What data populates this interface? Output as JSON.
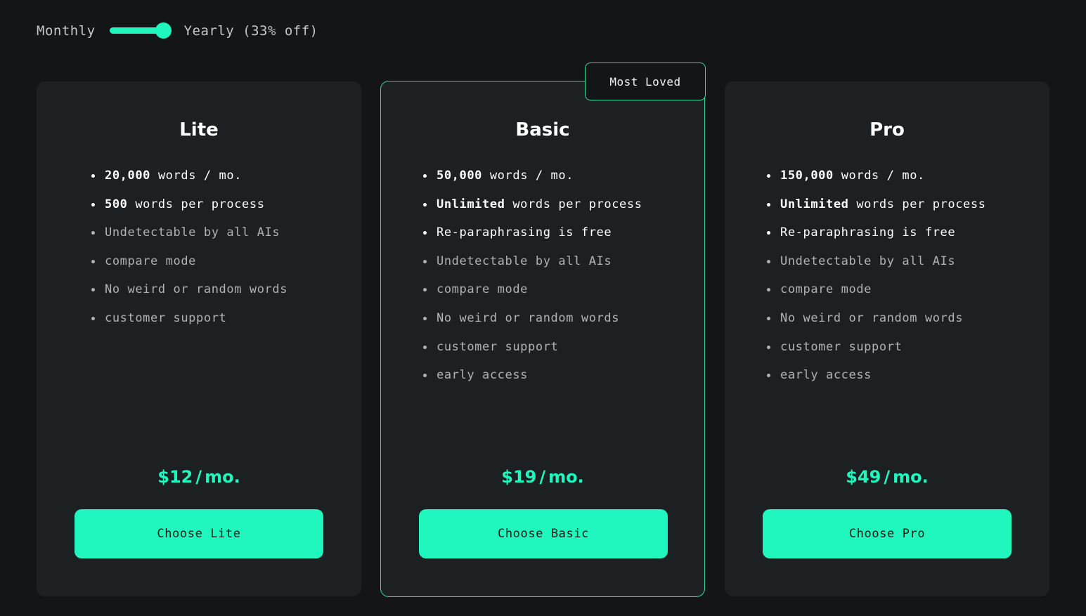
{
  "billing": {
    "monthly_label": "Monthly",
    "yearly_label": "Yearly (33% off)",
    "toggle_state": "yearly"
  },
  "colors": {
    "accent": "#1ff7be",
    "background": "#131517",
    "card": "#1d2023"
  },
  "plans": [
    {
      "name": "Lite",
      "features": [
        {
          "bold": "20,000",
          "text": " words / mo.",
          "highlight": true
        },
        {
          "bold": "500",
          "text": " words per process",
          "highlight": true
        },
        {
          "bold": "",
          "text": "Undetectable by all AIs",
          "highlight": false
        },
        {
          "bold": "",
          "text": "compare mode",
          "highlight": false
        },
        {
          "bold": "",
          "text": "No weird or random words",
          "highlight": false
        },
        {
          "bold": "",
          "text": "customer support",
          "highlight": false
        }
      ],
      "price": "$12",
      "price_unit": "mo.",
      "button_label": "Choose Lite"
    },
    {
      "name": "Basic",
      "badge": "Most Loved",
      "features": [
        {
          "bold": "50,000",
          "text": " words / mo.",
          "highlight": true
        },
        {
          "bold": "Unlimited",
          "text": " words per process",
          "highlight": true
        },
        {
          "bold": "",
          "text": "Re-paraphrasing is free",
          "highlight": true
        },
        {
          "bold": "",
          "text": "Undetectable by all AIs",
          "highlight": false
        },
        {
          "bold": "",
          "text": "compare mode",
          "highlight": false
        },
        {
          "bold": "",
          "text": "No weird or random words",
          "highlight": false
        },
        {
          "bold": "",
          "text": "customer support",
          "highlight": false
        },
        {
          "bold": "",
          "text": "early access",
          "highlight": false
        }
      ],
      "price": "$19",
      "price_unit": "mo.",
      "button_label": "Choose Basic"
    },
    {
      "name": "Pro",
      "features": [
        {
          "bold": "150,000",
          "text": " words / mo.",
          "highlight": true
        },
        {
          "bold": "Unlimited",
          "text": " words per process",
          "highlight": true
        },
        {
          "bold": "",
          "text": "Re-paraphrasing is free",
          "highlight": true
        },
        {
          "bold": "",
          "text": "Undetectable by all AIs",
          "highlight": false
        },
        {
          "bold": "",
          "text": "compare mode",
          "highlight": false
        },
        {
          "bold": "",
          "text": "No weird or random words",
          "highlight": false
        },
        {
          "bold": "",
          "text": "customer support",
          "highlight": false
        },
        {
          "bold": "",
          "text": "early access",
          "highlight": false
        }
      ],
      "price": "$49",
      "price_unit": "mo.",
      "button_label": "Choose Pro"
    }
  ]
}
